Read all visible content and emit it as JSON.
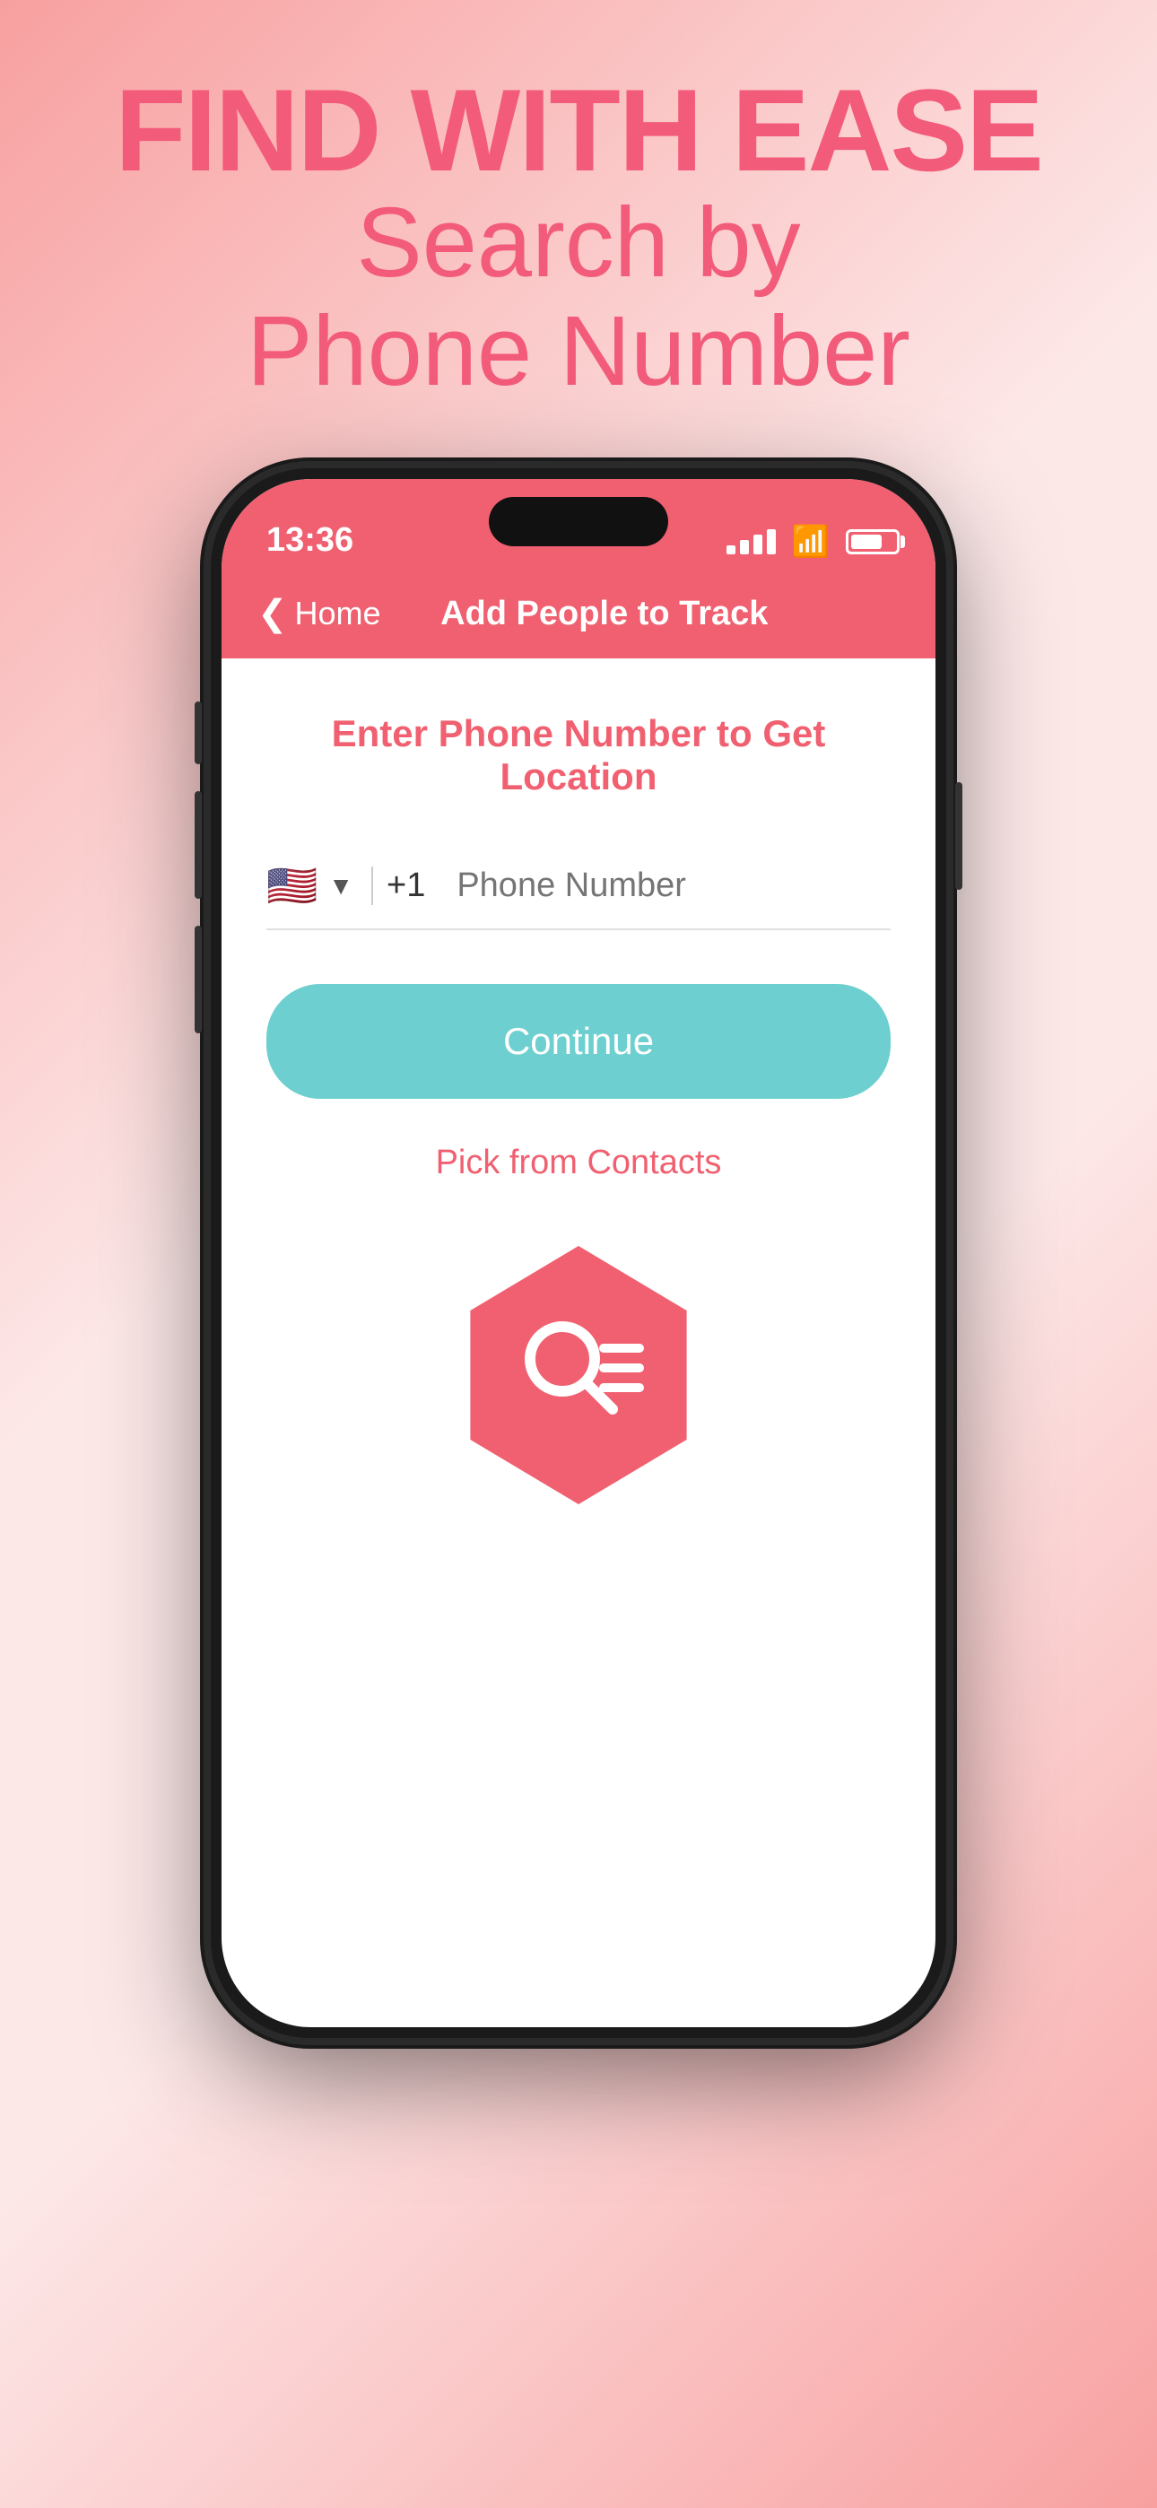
{
  "header": {
    "line1": "FIND WITH EASE",
    "line2": "Search by",
    "line3": "Phone Number"
  },
  "statusBar": {
    "time": "13:36",
    "signal": ".....",
    "wifi": "wifi",
    "battery": "battery"
  },
  "navigation": {
    "backLabel": "Home",
    "title": "Add People to Track"
  },
  "content": {
    "sectionTitle": "Enter Phone Number to Get Location",
    "flagEmoji": "🇺🇸",
    "countryCode": "+1",
    "phonePlaceholder": "Phone Number",
    "continueLabel": "Continue",
    "pickContactsLabel": "Pick from Contacts"
  },
  "colors": {
    "accent": "#f06070",
    "teal": "#6dcfcf",
    "white": "#ffffff"
  }
}
